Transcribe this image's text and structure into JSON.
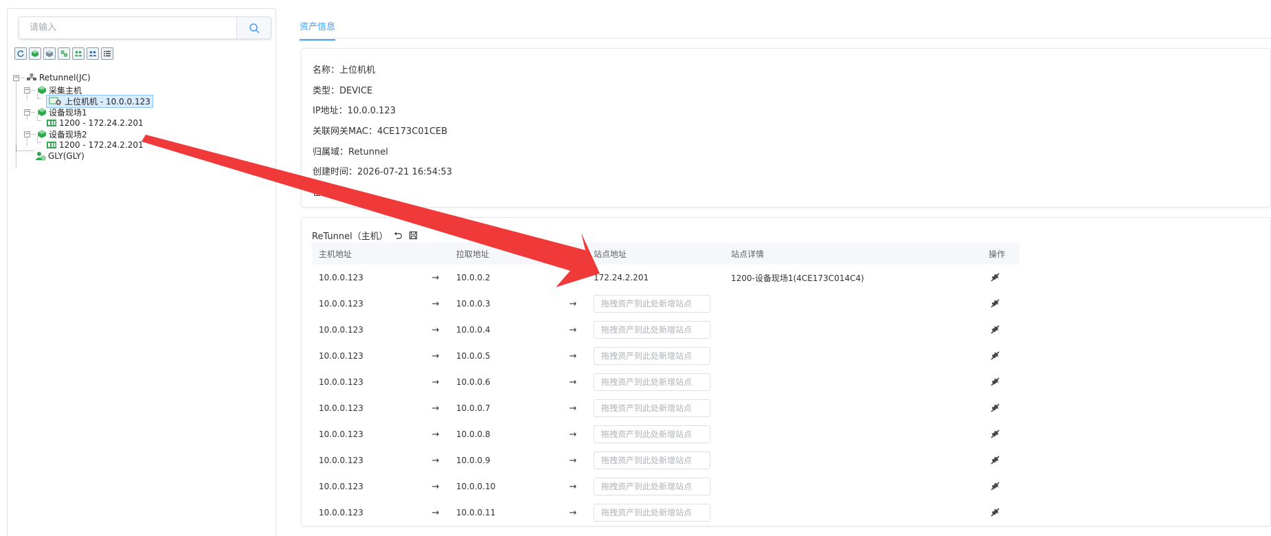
{
  "search": {
    "placeholder": "请输入"
  },
  "toolbar": {
    "buttons": [
      {
        "icon": "refresh-icon"
      },
      {
        "icon": "add-host-icon"
      },
      {
        "icon": "add-site-icon"
      },
      {
        "icon": "settings-group-icon"
      },
      {
        "icon": "users-icon"
      },
      {
        "icon": "user-group-icon"
      },
      {
        "icon": "list-icon"
      }
    ]
  },
  "tree": {
    "root": {
      "label": "Retunnel(JC)"
    },
    "nodes": [
      {
        "label": "采集主机"
      },
      {
        "label": "上位机机 - 10.0.0.123"
      },
      {
        "label": "设备现场1"
      },
      {
        "label": "1200 - 172.24.2.201"
      },
      {
        "label": "设备现场2"
      },
      {
        "label": "1200 - 172.24.2.201"
      },
      {
        "label": "GLY(GLY)"
      }
    ]
  },
  "tabs": {
    "asset_info": "资产信息"
  },
  "info": {
    "name": "名称：上位机机",
    "type": "类型：DEVICE",
    "ip": "IP地址：10.0.0.123",
    "gateway_mac": "关联网关MAC：4CE173C01CEB",
    "domain": "归属域：Retunnel",
    "created": "创建时间：2026-07-21 16:54:53",
    "remark": "备注："
  },
  "tunnel": {
    "title": "ReTunnel（主机）",
    "columns": [
      "主机地址",
      "",
      "拉取地址",
      "",
      "站点地址",
      "站点详情",
      "操作"
    ],
    "input_placeholder": "拖拽资产到此处新增站点",
    "rows": [
      {
        "host": "10.0.0.123",
        "pull": "10.0.0.2",
        "station": "172.24.2.201",
        "detail": "1200-设备现场1(4CE173C014C4)"
      },
      {
        "host": "10.0.0.123",
        "pull": "10.0.0.3",
        "station": "",
        "detail": ""
      },
      {
        "host": "10.0.0.123",
        "pull": "10.0.0.4",
        "station": "",
        "detail": ""
      },
      {
        "host": "10.0.0.123",
        "pull": "10.0.0.5",
        "station": "",
        "detail": ""
      },
      {
        "host": "10.0.0.123",
        "pull": "10.0.0.6",
        "station": "",
        "detail": ""
      },
      {
        "host": "10.0.0.123",
        "pull": "10.0.0.7",
        "station": "",
        "detail": ""
      },
      {
        "host": "10.0.0.123",
        "pull": "10.0.0.8",
        "station": "",
        "detail": ""
      },
      {
        "host": "10.0.0.123",
        "pull": "10.0.0.9",
        "station": "",
        "detail": ""
      },
      {
        "host": "10.0.0.123",
        "pull": "10.0.0.10",
        "station": "",
        "detail": ""
      },
      {
        "host": "10.0.0.123",
        "pull": "10.0.0.11",
        "station": "",
        "detail": ""
      }
    ],
    "arrow_glyph": "→"
  },
  "colors": {
    "accent": "#409eff",
    "tree_green": "#2fa84f",
    "annotation_red": "#f03a3a"
  }
}
